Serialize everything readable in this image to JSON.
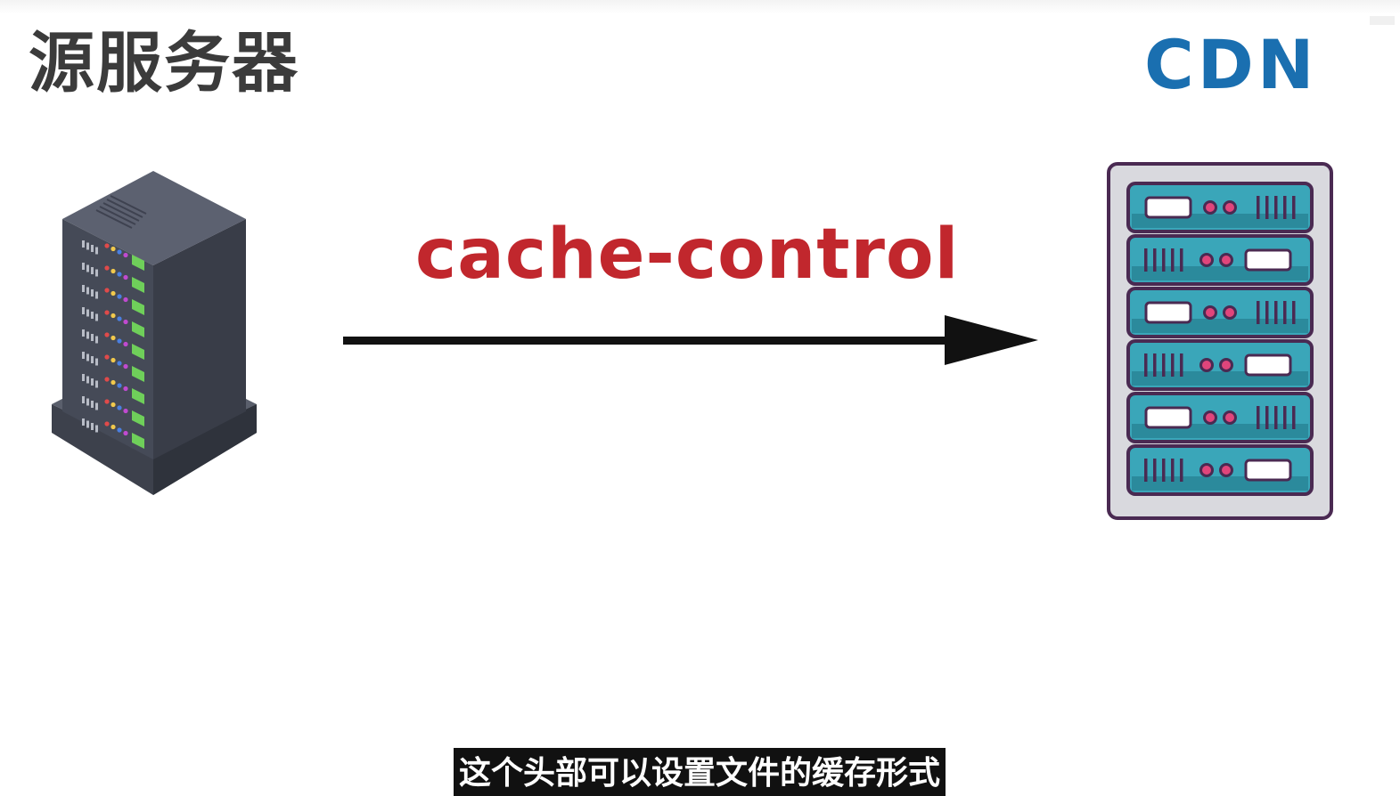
{
  "diagram": {
    "origin_label": "源服务器",
    "cdn_label": "CDN",
    "header_name": "cache-control"
  },
  "subtitle": {
    "text": "这个头部可以设置文件的缓存形式"
  },
  "colors": {
    "origin_label": "#3b3b3b",
    "cdn_label": "#1a6fb0",
    "header_name": "#c1272d",
    "arrow": "#111111",
    "cdn_rack_frame": "#4a2a52",
    "cdn_rack_unit": "#3aa6b9",
    "origin_server_body": "#454a57"
  },
  "icons": {
    "origin": "server-tower-icon",
    "cdn": "server-rack-icon"
  }
}
